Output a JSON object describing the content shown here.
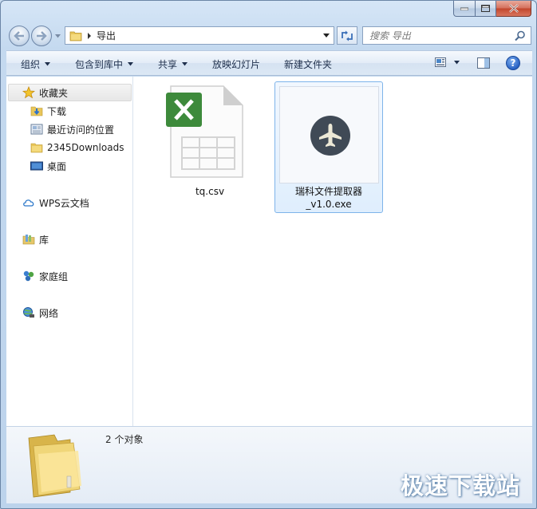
{
  "address": {
    "path": "导出"
  },
  "search": {
    "placeholder": "搜索 导出"
  },
  "toolbar": {
    "organize": "组织",
    "include_in_library": "包含到库中",
    "share": "共享",
    "slideshow": "放映幻灯片",
    "new_folder": "新建文件夹"
  },
  "sidebar": {
    "favorites": "收藏夹",
    "favorites_items": [
      "下载",
      "最近访问的位置",
      "2345Downloads",
      "桌面"
    ],
    "wps_cloud": "WPS云文档",
    "library": "库",
    "homegroup": "家庭组",
    "network": "网络"
  },
  "files": [
    {
      "name": "tq.csv",
      "type": "excel-csv"
    },
    {
      "name_line1": "瑞科文件提取器",
      "name_line2": "_v1.0.exe",
      "type": "exe"
    }
  ],
  "details": {
    "count": "2 个对象"
  },
  "watermark": "极速下载站",
  "colors": {
    "excel_green": "#3d8a3b",
    "exe_circle": "#404a56",
    "selection": "#7eb4ea"
  }
}
